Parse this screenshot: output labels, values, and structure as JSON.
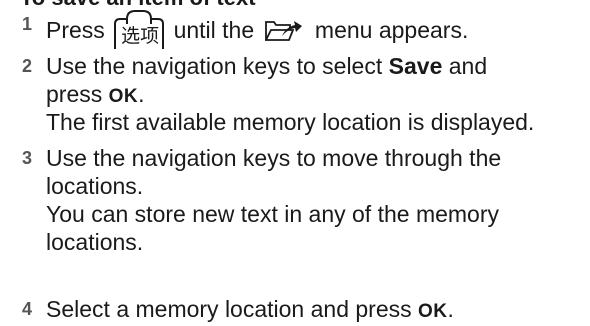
{
  "section_heading": "To save an item of text",
  "options_key": {
    "icon": "options-key-icon",
    "label": "选项"
  },
  "menu_icon": "messaging-folder-icon",
  "steps": [
    {
      "number": "1",
      "before_key": "Press",
      "after_key": "until the",
      "after_icon": "menu appears."
    },
    {
      "number": "2",
      "line1": "Use the navigation keys to select",
      "keyword": "Save",
      "line1_end": "and",
      "line2_start": "press",
      "line2_key": "OK",
      "line2_end": ".",
      "note": "The first available memory location is displayed."
    },
    {
      "number": "3",
      "line1": "Use the navigation keys to move through the",
      "line2": "locations.",
      "note1": "You can store new text in any of the memory",
      "note2": "locations."
    },
    {
      "number": "4",
      "text": "Select a memory location and press",
      "key": "OK",
      "end": "."
    }
  ]
}
